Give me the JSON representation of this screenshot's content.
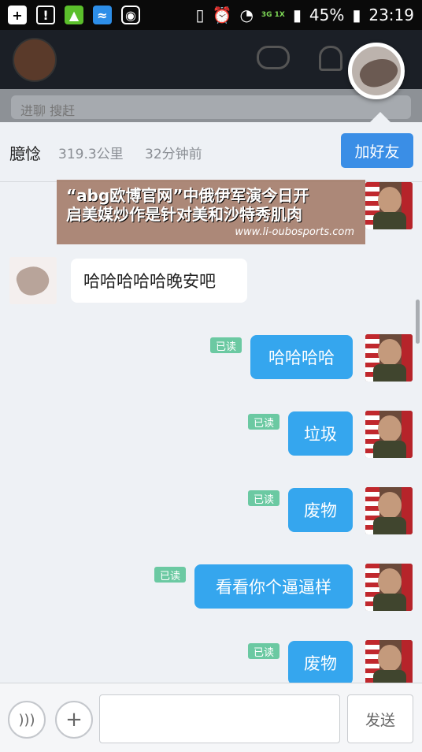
{
  "status_bar": {
    "network": "3G\n1X",
    "battery": "45%",
    "time": "23:19"
  },
  "search_strip": {
    "text": "进聊    搜赶"
  },
  "profile": {
    "name": "臆惗",
    "distance": "319.3公里",
    "last_seen": "32分钟前",
    "add_friend_label": "加好友"
  },
  "watermark": {
    "line1": "“abg欧博官网”中俄伊军演今日开",
    "line2": "启美媒炒作是针对美和沙特秀肌肉",
    "url": "www.li-oubosports.com"
  },
  "messages": [
    {
      "side": "in",
      "text": "哈哈哈哈哈晚安吧"
    },
    {
      "side": "out",
      "text": "哈哈哈哈",
      "status": "已读"
    },
    {
      "side": "out",
      "text": "垃圾",
      "status": "已读"
    },
    {
      "side": "out",
      "text": "废物",
      "status": "已读"
    },
    {
      "side": "out",
      "text": "看看你个逼逼样",
      "status": "已读"
    },
    {
      "side": "out",
      "text": "废物",
      "status": "已读"
    }
  ],
  "input_bar": {
    "voice_icon": "voice-icon",
    "plus_icon": "plus-icon",
    "send_label": "发送"
  }
}
